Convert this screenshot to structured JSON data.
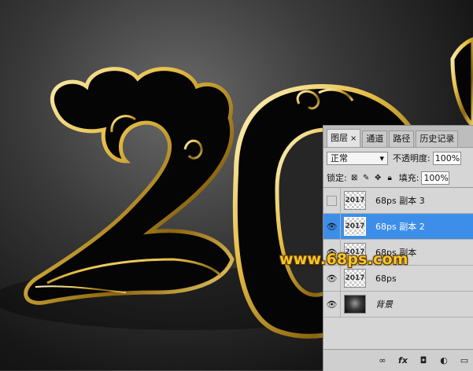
{
  "watermark": "www.68ps.com",
  "colors": {
    "accent_gold": "#e2b52a",
    "selection": "#3d8ee9",
    "panel_bg": "#d6d6d6"
  },
  "layers_panel": {
    "tabs": [
      {
        "label": "图层",
        "active": true,
        "close": "×"
      },
      {
        "label": "通道"
      },
      {
        "label": "路径"
      },
      {
        "label": "历史记录"
      }
    ],
    "blend_mode": "正常",
    "opacity_label": "不透明度:",
    "opacity_value": "100%",
    "lock_label": "锁定:",
    "fill_label": "填充:",
    "fill_value": "100%",
    "layers": [
      {
        "name": "68ps  副本 3",
        "visible": false,
        "thumb_text": "2017",
        "selected": false
      },
      {
        "name": "68ps  副本 2",
        "visible": true,
        "thumb_text": "2017",
        "selected": true
      },
      {
        "name": "68ps  副本",
        "visible": true,
        "thumb_text": "2017",
        "selected": false
      },
      {
        "name": "68ps",
        "visible": true,
        "thumb_text": "2017",
        "selected": false
      },
      {
        "name": "背景",
        "visible": true,
        "thumb_text": "",
        "selected": false
      }
    ],
    "bottom_icons": [
      "link-icon",
      "fx-icon",
      "mask-icon",
      "adjustment-icon",
      "group-icon"
    ],
    "bottom_labels": {
      "link": "∞",
      "fx": "fx",
      "mask": "◘",
      "adjustment": "◐",
      "group": "▭"
    }
  }
}
